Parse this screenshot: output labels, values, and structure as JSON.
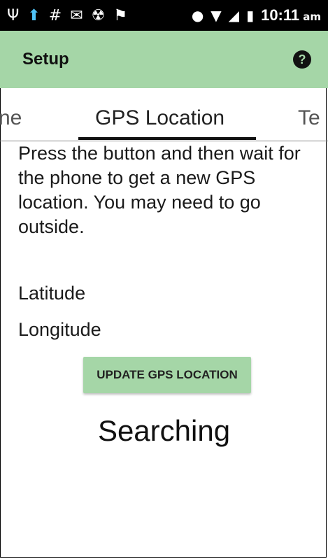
{
  "statusbar": {
    "icons_left": [
      "usb-icon",
      "upload-icon",
      "hash-icon",
      "mail-icon",
      "android-debug-icon",
      "nfc-icon"
    ],
    "icons_left_glyphs": [
      "Ψ",
      "⬆",
      "#",
      "✉",
      "☢",
      "⚑"
    ],
    "icons_right": [
      "location-icon",
      "wifi-icon",
      "signal-icon",
      "battery-icon"
    ],
    "icons_right_glyphs": [
      "●",
      "▼",
      "◢",
      "▮"
    ],
    "time": "10:11",
    "ampm": "am"
  },
  "appbar": {
    "title": "Setup",
    "help_label": "?"
  },
  "tabs": {
    "prev": "ne",
    "active": "GPS Location",
    "next": "Te"
  },
  "main": {
    "instructions": "Press the button and then wait for the phone to get a new GPS location. You may need to go outside.",
    "latitude_label": "Latitude",
    "longitude_label": "Longitude",
    "update_button": "UPDATE GPS LOCATION",
    "status": "Searching"
  },
  "colors": {
    "accent": "#a5d6a7",
    "statusbar": "#000000"
  }
}
